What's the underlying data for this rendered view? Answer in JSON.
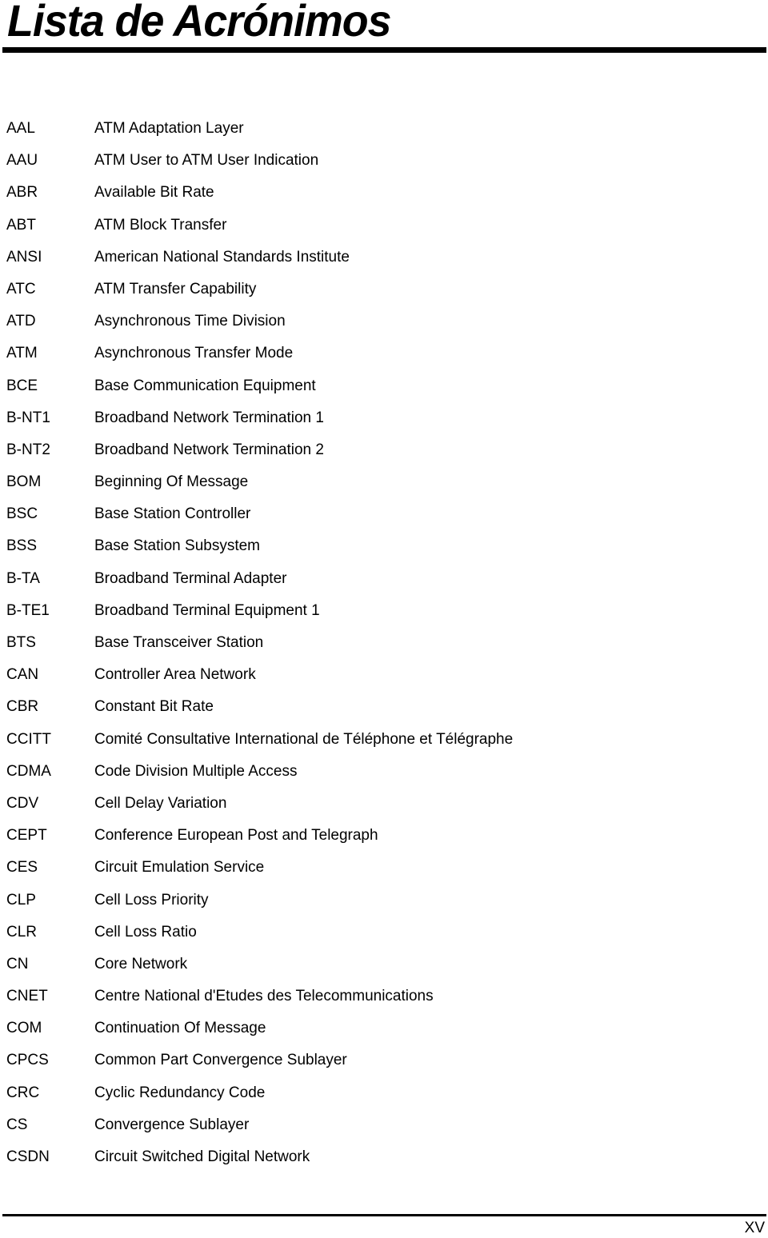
{
  "page": {
    "title": "Lista de Acrónimos",
    "page_number": "XV"
  },
  "acronyms": [
    {
      "term": "AAL",
      "definition": "ATM Adaptation Layer"
    },
    {
      "term": "AAU",
      "definition": "ATM User to ATM User Indication"
    },
    {
      "term": "ABR",
      "definition": "Available Bit Rate"
    },
    {
      "term": "ABT",
      "definition": "ATM Block Transfer"
    },
    {
      "term": "ANSI",
      "definition": "American National Standards Institute"
    },
    {
      "term": "ATC",
      "definition": "ATM Transfer Capability"
    },
    {
      "term": "ATD",
      "definition": "Asynchronous Time Division"
    },
    {
      "term": "ATM",
      "definition": "Asynchronous Transfer Mode"
    },
    {
      "term": "BCE",
      "definition": "Base Communication Equipment"
    },
    {
      "term": "B-NT1",
      "definition": "Broadband Network Termination 1"
    },
    {
      "term": "B-NT2",
      "definition": "Broadband Network Termination 2"
    },
    {
      "term": "BOM",
      "definition": "Beginning Of Message"
    },
    {
      "term": "BSC",
      "definition": "Base Station Controller"
    },
    {
      "term": "BSS",
      "definition": "Base Station Subsystem"
    },
    {
      "term": "B-TA",
      "definition": "Broadband Terminal Adapter"
    },
    {
      "term": "B-TE1",
      "definition": "Broadband Terminal Equipment 1"
    },
    {
      "term": "BTS",
      "definition": "Base Transceiver Station"
    },
    {
      "term": "CAN",
      "definition": "Controller Area Network"
    },
    {
      "term": "CBR",
      "definition": "Constant Bit Rate"
    },
    {
      "term": "CCITT",
      "definition": "Comité Consultative International de Téléphone et Télégraphe"
    },
    {
      "term": "CDMA",
      "definition": "Code Division Multiple Access"
    },
    {
      "term": "CDV",
      "definition": "Cell Delay Variation"
    },
    {
      "term": "CEPT",
      "definition": "Conference European Post and Telegraph"
    },
    {
      "term": "CES",
      "definition": "Circuit Emulation Service"
    },
    {
      "term": "CLP",
      "definition": "Cell Loss Priority"
    },
    {
      "term": "CLR",
      "definition": "Cell Loss Ratio"
    },
    {
      "term": "CN",
      "definition": "Core Network"
    },
    {
      "term": "CNET",
      "definition": "Centre National d'Etudes des Telecommunications"
    },
    {
      "term": "COM",
      "definition": "Continuation Of Message"
    },
    {
      "term": "CPCS",
      "definition": "Common Part Convergence Sublayer"
    },
    {
      "term": "CRC",
      "definition": "Cyclic Redundancy Code"
    },
    {
      "term": "CS",
      "definition": "Convergence Sublayer"
    },
    {
      "term": "CSDN",
      "definition": "Circuit Switched Digital Network"
    }
  ]
}
